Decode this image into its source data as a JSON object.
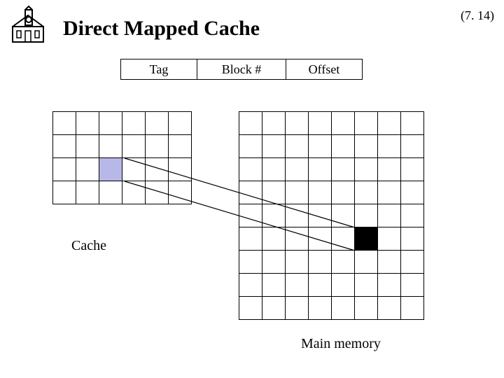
{
  "page_number": "(7. 14)",
  "title": "Direct Mapped Cache",
  "address_fields": {
    "tag": "Tag",
    "block": "Block #",
    "offset": "Offset"
  },
  "labels": {
    "cache": "Cache",
    "memory": "Main memory"
  },
  "cache_grid": {
    "rows": 4,
    "cols": 6,
    "highlight": {
      "row": 2,
      "col": 2,
      "style": "blue"
    }
  },
  "memory_grid": {
    "rows": 9,
    "cols": 8,
    "highlight": {
      "row": 5,
      "col": 5,
      "style": "black"
    }
  },
  "mapping": {
    "from": "cache.highlight",
    "to": "memory.highlight"
  },
  "icon": "building-icon"
}
